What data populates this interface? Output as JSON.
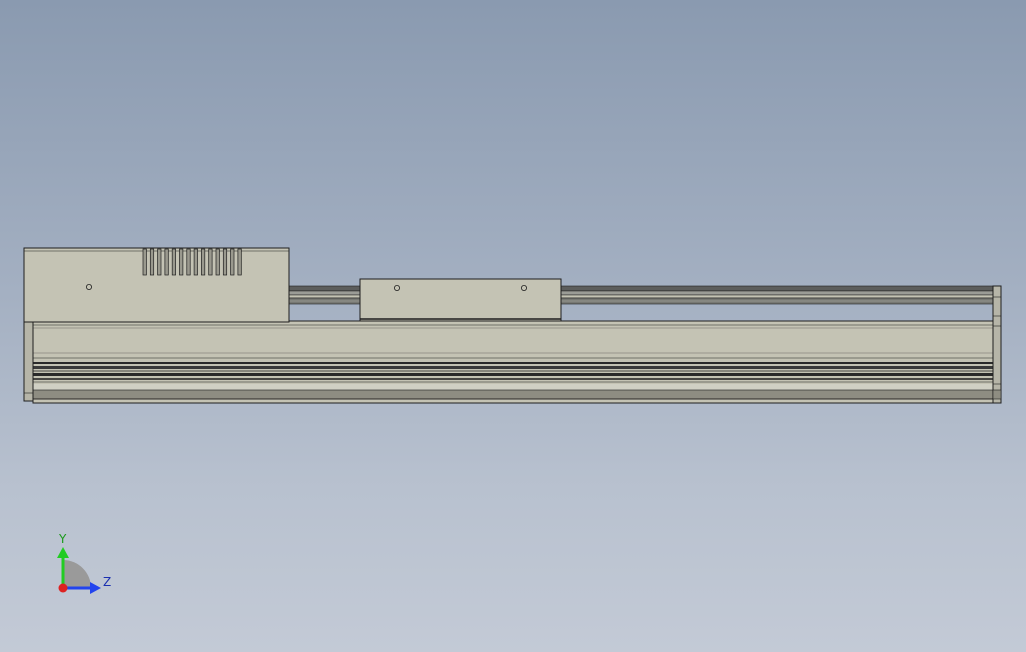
{
  "viewport": {
    "background_top": "#8a9ab0",
    "background_bottom": "#c3cad6"
  },
  "model": {
    "body_color": "#c4c3b4",
    "edge_color": "#1e1e1e",
    "shadow_color": "#8e8d82"
  },
  "triad": {
    "y_label": "Y",
    "z_label": "Z",
    "y_color": "#22cc22",
    "z_color": "#2244ee",
    "x_color": "#dd2222"
  }
}
